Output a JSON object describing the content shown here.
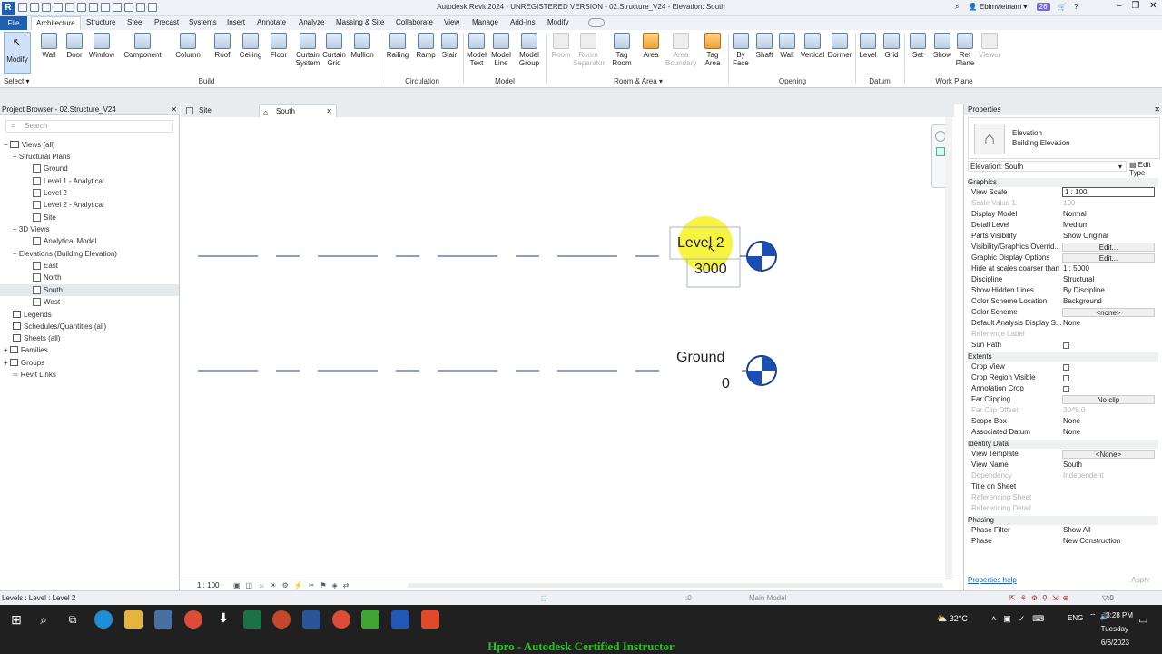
{
  "window": {
    "title": "Autodesk Revit 2024 - UNREGISTERED VERSION - 02.Structure_V24 - Elevation: South",
    "user": "Ebimvietnam",
    "notifications": "26"
  },
  "tabs": [
    "File",
    "Architecture",
    "Structure",
    "Steel",
    "Precast",
    "Systems",
    "Insert",
    "Annotate",
    "Analyze",
    "Massing & Site",
    "Collaborate",
    "View",
    "Manage",
    "Add-Ins",
    "Modify"
  ],
  "ribbon": {
    "modify": "Modify",
    "select": "Select",
    "buttons": [
      {
        "id": "wall",
        "label": "Wall"
      },
      {
        "id": "door",
        "label": "Door"
      },
      {
        "id": "window",
        "label": "Window"
      },
      {
        "id": "component",
        "label": "Component"
      },
      {
        "id": "column",
        "label": "Column"
      },
      {
        "id": "roof",
        "label": "Roof"
      },
      {
        "id": "ceiling",
        "label": "Ceiling"
      },
      {
        "id": "floor",
        "label": "Floor"
      },
      {
        "id": "curtain-system",
        "label": "Curtain System"
      },
      {
        "id": "curtain-grid",
        "label": "Curtain Grid"
      },
      {
        "id": "mullion",
        "label": "Mullion"
      },
      {
        "id": "railing",
        "label": "Railing"
      },
      {
        "id": "ramp",
        "label": "Ramp"
      },
      {
        "id": "stair",
        "label": "Stair"
      },
      {
        "id": "model-text",
        "label": "Model Text"
      },
      {
        "id": "model-line",
        "label": "Model Line"
      },
      {
        "id": "model-group",
        "label": "Model Group"
      },
      {
        "id": "room",
        "label": "Room"
      },
      {
        "id": "room-separator",
        "label": "Room Separator"
      },
      {
        "id": "tag-room",
        "label": "Tag Room"
      },
      {
        "id": "area",
        "label": "Area"
      },
      {
        "id": "area-boundary",
        "label": "Area Boundary"
      },
      {
        "id": "tag-area",
        "label": "Tag Area"
      },
      {
        "id": "by-face",
        "label": "By Face"
      },
      {
        "id": "shaft",
        "label": "Shaft"
      },
      {
        "id": "op-wall",
        "label": "Wall"
      },
      {
        "id": "vertical",
        "label": "Vertical"
      },
      {
        "id": "dormer",
        "label": "Dormer"
      },
      {
        "id": "level",
        "label": "Level"
      },
      {
        "id": "grid",
        "label": "Grid"
      },
      {
        "id": "set",
        "label": "Set"
      },
      {
        "id": "show",
        "label": "Show"
      },
      {
        "id": "ref-plane",
        "label": "Ref Plane"
      },
      {
        "id": "viewer",
        "label": "Viewer"
      }
    ],
    "groups": [
      "Build",
      "Circulation",
      "Model",
      "Room & Area",
      "Opening",
      "Datum",
      "Work Plane"
    ]
  },
  "project_browser": {
    "title": "Project Browser - 02.Structure_V24",
    "search": "Search",
    "items": [
      "Views (all)",
      "Structural Plans",
      "Ground",
      "Level 1 - Analytical",
      "Level 2",
      "Level 2 - Analytical",
      "Site",
      "3D Views",
      "Analytical Model",
      "Elevations (Building Elevation)",
      "East",
      "North",
      "South",
      "West",
      "Legends",
      "Schedules/Quantities (all)",
      "Sheets (all)",
      "Families",
      "Groups",
      "Revit Links"
    ]
  },
  "view_tabs": [
    "Site",
    "South"
  ],
  "canvas": {
    "levels": [
      {
        "name": "Level 2",
        "elevation": "3000"
      },
      {
        "name": "Ground",
        "elevation": "0"
      }
    ],
    "scale": "1 : 100"
  },
  "properties": {
    "title": "Properties",
    "type_name": "Elevation",
    "type_sub": "Building Elevation",
    "selector": "Elevation: South",
    "edit_type": "Edit Type",
    "sections": {
      "graphics": "Graphics",
      "extents": "Extents",
      "identity": "Identity Data",
      "phasing": "Phasing"
    },
    "rows": {
      "view_scale": [
        "View Scale",
        "1 : 100"
      ],
      "scale_value": [
        "Scale Value 1:",
        "100"
      ],
      "display_model": [
        "Display Model",
        "Normal"
      ],
      "detail_level": [
        "Detail Level",
        "Medium"
      ],
      "parts_visibility": [
        "Parts Visibility",
        "Show Original"
      ],
      "vg_overrides": [
        "Visibility/Graphics Overrid...",
        "Edit..."
      ],
      "graphic_display": [
        "Graphic Display Options",
        "Edit..."
      ],
      "hide_scales": [
        "Hide at scales coarser than",
        "1 : 5000"
      ],
      "discipline": [
        "Discipline",
        "Structural"
      ],
      "hidden_lines": [
        "Show Hidden Lines",
        "By Discipline"
      ],
      "color_scheme_loc": [
        "Color Scheme Location",
        "Background"
      ],
      "color_scheme": [
        "Color Scheme",
        "<none>"
      ],
      "default_analysis": [
        "Default Analysis Display S...",
        "None"
      ],
      "reference_label": [
        "Reference Label",
        ""
      ],
      "sun_path": [
        "Sun Path",
        ""
      ],
      "crop_view": [
        "Crop View",
        ""
      ],
      "crop_region": [
        "Crop Region Visible",
        ""
      ],
      "annotation_crop": [
        "Annotation Crop",
        ""
      ],
      "far_clipping": [
        "Far Clipping",
        "No clip"
      ],
      "far_clip_offset": [
        "Far Clip Offset",
        "3048.0"
      ],
      "scope_box": [
        "Scope Box",
        "None"
      ],
      "associated_datum": [
        "Associated Datum",
        "None"
      ],
      "view_template": [
        "View Template",
        "<None>"
      ],
      "view_name": [
        "View Name",
        "South"
      ],
      "dependency": [
        "Dependency",
        "Independent"
      ],
      "title_on_sheet": [
        "Title on Sheet",
        ""
      ],
      "ref_sheet": [
        "Referencing Sheet",
        ""
      ],
      "ref_detail": [
        "Referencing Detail",
        ""
      ],
      "phase_filter": [
        "Phase Filter",
        "Show All"
      ],
      "phase": [
        "Phase",
        "New Construction"
      ]
    },
    "help": "Properties help",
    "apply": "Apply"
  },
  "status": {
    "left": "Levels : Level : Level 2",
    "model": "Main Model",
    "zero": ":0"
  },
  "taskbar": {
    "temp": "32°C",
    "lang": "ENG",
    "time": "3:28 PM",
    "day": "Tuesday",
    "date": "6/6/2023"
  },
  "caption": "Hpro - Autodesk Certified Instructor"
}
